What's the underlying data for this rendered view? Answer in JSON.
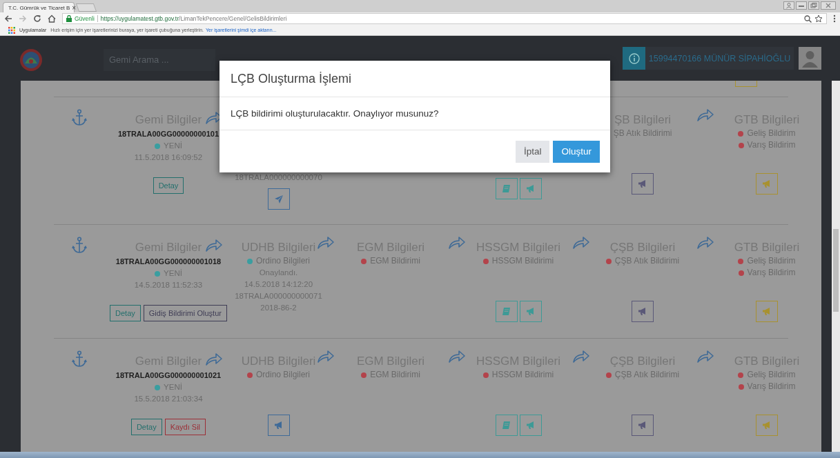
{
  "browser": {
    "tab_title": "T.C. Gümrük ve Ticaret B",
    "tab_close": "×",
    "url_secure": "Güvenli",
    "url_host": "https://uygulamatest.gtb.gov.tr",
    "url_path": "/LimanTekPencere/Genel/GelisBildirimleri",
    "bookmarks_apps": "Uygulamalar",
    "bookmarks_hint": "Hızlı erişim için yer işaretlerinizi buraya, yer işareti çubuğuna yerleştirin.",
    "bookmarks_link": "Yer işaretlerini şimdi içe aktarın..."
  },
  "header": {
    "search": {
      "placeholder": "Gemi Arama ..."
    },
    "user": "15994470166 MÜNÜR SİPAHİOĞLU"
  },
  "previous_row": {
    "actions": [
      {
        "color": "#a8912f"
      }
    ]
  },
  "rows": [
    {
      "sections": [
        {
          "kind": "ship",
          "title": "Gemi Bilgiler",
          "arrow": true,
          "id": "18TRALA00GG00000000101",
          "status": {
            "text": "YENİ",
            "color": "#3a9ea0"
          },
          "date": "11.5.2018 16:09:52",
          "buttons": [
            {
              "label": "Detay",
              "color": "#236f6c"
            }
          ]
        },
        {
          "kind": "agency",
          "arrow": false,
          "lines": [
            "18TRALA000000000070"
          ],
          "actions": [
            {
              "kind": "send",
              "color": "#3e6a98"
            }
          ]
        },
        {
          "arrow": false
        },
        {
          "kind": "agency",
          "arrow": false,
          "actions": [
            {
              "kind": "book",
              "color": "#3d9a96"
            },
            {
              "kind": "announce",
              "color": "#3d9a96"
            }
          ]
        },
        {
          "kind": "agency",
          "title": "ŞB Bilgileri",
          "arrow": true,
          "statuses": [
            {
              "text": "ŞB Atık Bildirimi"
            }
          ],
          "actions": [
            {
              "kind": "announce",
              "color": "#5a5878"
            }
          ]
        },
        {
          "kind": "agency",
          "title": "GTB Bilgileri",
          "arrow": false,
          "statuses": [
            {
              "text": "Geliş Bildirim",
              "color": "#b3434b"
            },
            {
              "text": "Varış Bildirim",
              "color": "#b3434b"
            }
          ],
          "actions": [
            {
              "kind": "announce",
              "color": "#a8912f"
            }
          ]
        }
      ]
    },
    {
      "sections": [
        {
          "kind": "ship",
          "title": "Gemi Bilgiler",
          "arrow": true,
          "id": "18TRALA00GG000000001018",
          "status": {
            "text": "YENİ",
            "color": "#3a9ea0"
          },
          "date": "14.5.2018 11:52:33",
          "buttons": [
            {
              "label": "Detay",
              "color": "#236f6c"
            },
            {
              "label": "Gidiş Bildirimi Oluştur",
              "color": "#3f3d55"
            }
          ]
        },
        {
          "kind": "agency",
          "title": "UDHB Bilgileri",
          "arrow": true,
          "statuses": [
            {
              "text": "Ordino Bilgileri",
              "color": "#3a9ea0"
            }
          ],
          "lines": [
            "Onaylandı.",
            "14.5.2018 14:12:20",
            "18TRALA000000000071",
            "2018-86-2"
          ]
        },
        {
          "kind": "agency",
          "title": "EGM Bilgileri",
          "arrow": true,
          "statuses": [
            {
              "text": "EGM Bildirimi",
              "color": "#b3434b"
            }
          ]
        },
        {
          "kind": "agency",
          "title": "HSSGM Bilgileri",
          "arrow": true,
          "statuses": [
            {
              "text": "HSSGM Bildirimi",
              "color": "#b3434b"
            }
          ],
          "actions": [
            {
              "kind": "book",
              "color": "#3d9a96"
            },
            {
              "kind": "announce",
              "color": "#3d9a96"
            }
          ]
        },
        {
          "kind": "agency",
          "title": "ÇŞB Bilgileri",
          "arrow": true,
          "statuses": [
            {
              "text": "ÇŞB Atık Bildirimi",
              "color": "#b3434b"
            }
          ],
          "actions": [
            {
              "kind": "announce",
              "color": "#5a5878"
            }
          ]
        },
        {
          "kind": "agency",
          "title": "GTB Bilgileri",
          "arrow": false,
          "statuses": [
            {
              "text": "Geliş Bildirim",
              "color": "#b3434b"
            },
            {
              "text": "Varış Bildirim",
              "color": "#b3434b"
            }
          ],
          "actions": [
            {
              "kind": "announce",
              "color": "#a8912f"
            }
          ]
        }
      ]
    },
    {
      "sections": [
        {
          "kind": "ship",
          "title": "Gemi Bilgiler",
          "arrow": true,
          "id": "18TRALA00GG000000001021",
          "status": {
            "text": "YENİ",
            "color": "#3a9ea0"
          },
          "date": "15.5.2018 21:03:34",
          "buttons": [
            {
              "label": "Detay",
              "color": "#236f6c"
            },
            {
              "label": "Kaydı Sil",
              "color": "#9c2f37"
            }
          ]
        },
        {
          "kind": "agency",
          "title": "UDHB Bilgileri",
          "arrow": true,
          "statuses": [
            {
              "text": "Ordino Bilgileri",
              "color": "#b3434b"
            }
          ],
          "actions": [
            {
              "kind": "announce",
              "color": "#3e6a98"
            }
          ]
        },
        {
          "kind": "agency",
          "title": "EGM Bilgileri",
          "arrow": true,
          "statuses": [
            {
              "text": "EGM Bildirimi",
              "color": "#b3434b"
            }
          ]
        },
        {
          "kind": "agency",
          "title": "HSSGM Bilgileri",
          "arrow": true,
          "statuses": [
            {
              "text": "HSSGM Bildirimi",
              "color": "#b3434b"
            }
          ],
          "actions": [
            {
              "kind": "book",
              "color": "#3d9a96"
            },
            {
              "kind": "announce",
              "color": "#3d9a96"
            }
          ]
        },
        {
          "kind": "agency",
          "title": "ÇŞB Bilgileri",
          "arrow": true,
          "statuses": [
            {
              "text": "ÇŞB Atık Bildirimi",
              "color": "#b3434b"
            }
          ],
          "actions": [
            {
              "kind": "announce",
              "color": "#5a5878"
            }
          ]
        },
        {
          "kind": "agency",
          "title": "GTB Bilgileri",
          "arrow": false,
          "statuses": [
            {
              "text": "Geliş Bildirim",
              "color": "#b3434b"
            },
            {
              "text": "Varış Bildirim",
              "color": "#b3434b"
            }
          ],
          "actions": [
            {
              "kind": "announce",
              "color": "#a8912f"
            }
          ]
        }
      ]
    }
  ],
  "dialog": {
    "title": "LÇB Oluşturma İşlemi",
    "message": "LÇB bildirimi oluşturulacaktır. Onaylıyor musunuz?",
    "buttons": [
      {
        "label": "İptal",
        "kind": "secondary"
      },
      {
        "label": "Oluştur",
        "kind": "primary"
      }
    ]
  }
}
